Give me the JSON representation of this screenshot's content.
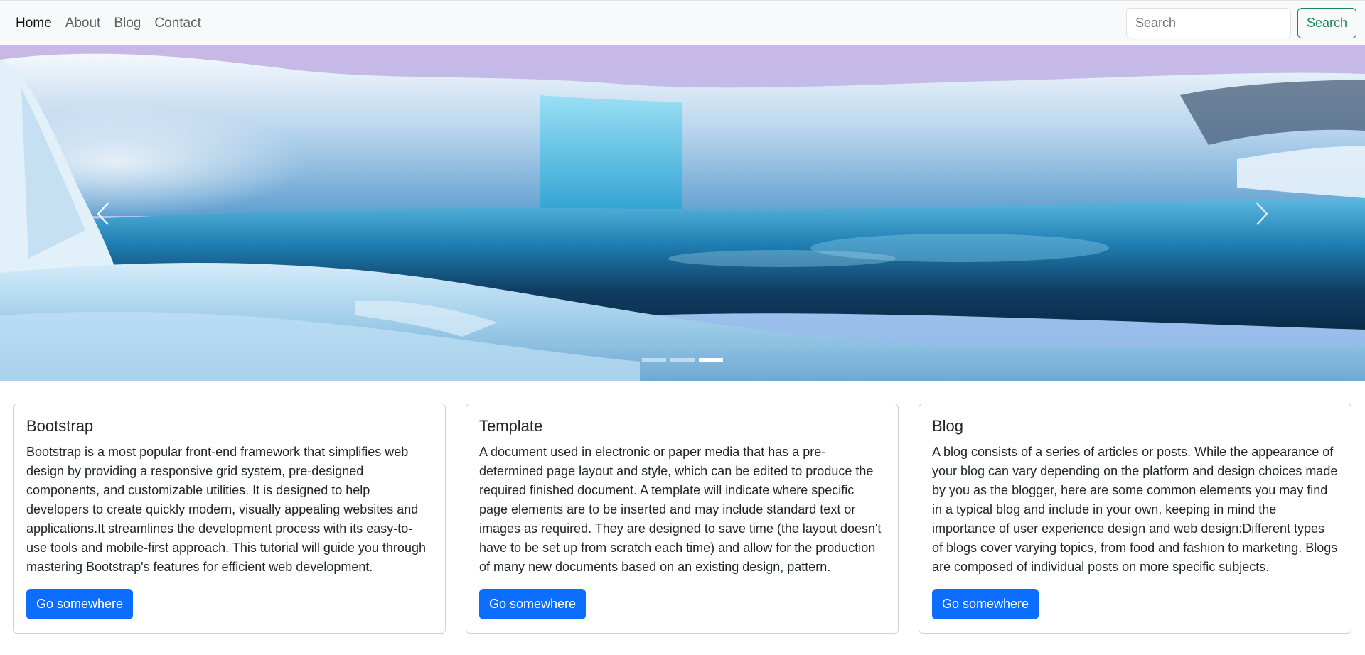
{
  "navbar": {
    "links": [
      {
        "label": "Home"
      },
      {
        "label": "About"
      },
      {
        "label": "Blog"
      },
      {
        "label": "Contact"
      }
    ],
    "search": {
      "placeholder": "Search",
      "value": "",
      "button_label": "Search"
    }
  },
  "carousel": {
    "image": "frozen-waterfall-landscape",
    "slide_count": 3,
    "active_slide": 3,
    "prev_icon": "chevron-left-icon",
    "next_icon": "chevron-right-icon"
  },
  "cards": [
    {
      "title": "Bootstrap",
      "text": "Bootstrap is a most popular front-end framework that simplifies web design by providing a responsive grid system, pre-designed components, and customizable utilities. It is designed to help developers to create quickly modern, visually appealing websites and applications.It streamlines the development process with its easy-to-use tools and mobile-first approach. This tutorial will guide you through mastering Bootstrap's features for efficient web development.",
      "button_label": "Go somewhere"
    },
    {
      "title": "Template",
      "text": "A document used in electronic or paper media that has a pre-determined page layout and style, which can be edited to produce the required finished document. A template will indicate where specific page elements are to be inserted and may include standard text or images as required. They are designed to save time (the layout doesn't have to be set up from scratch each time) and allow for the production of many new documents based on an existing design, pattern.",
      "button_label": "Go somewhere"
    },
    {
      "title": "Blog",
      "text": "A blog consists of a series of articles or posts. While the appearance of your blog can vary depending on the platform and design choices made by you as the blogger, here are some common elements you may find in a typical blog and include in your own, keeping in mind the importance of user experience design and web design:Different types of blogs cover varying topics, from food and fashion to marketing. Blogs are composed of individual posts on more specific subjects.",
      "button_label": "Go somewhere"
    }
  ],
  "colors": {
    "navbar_bg": "#f8f9fa",
    "search_button": "#198754",
    "primary_button": "#0d6efd"
  }
}
